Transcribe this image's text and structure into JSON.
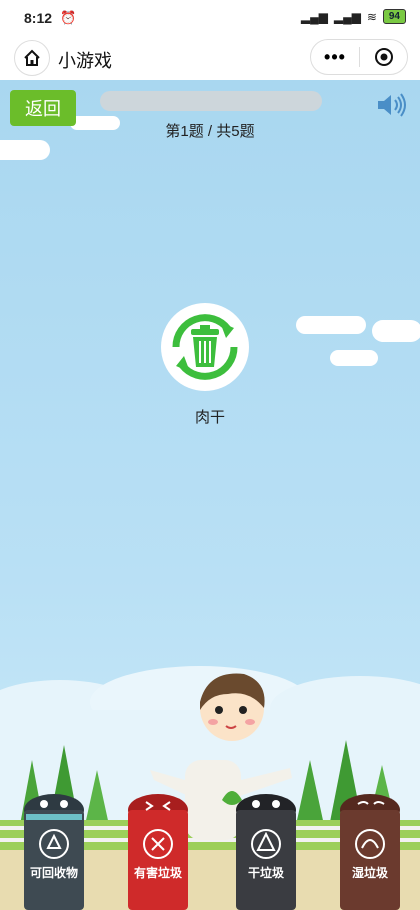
{
  "status": {
    "time": "8:12",
    "battery": "94"
  },
  "nav": {
    "title": "小游戏"
  },
  "game": {
    "back_label": "返回",
    "progress_fraction": 0,
    "question_counter": "第1题 / 共5题",
    "item_name": "肉干",
    "bins": [
      {
        "label": "可回收物",
        "color": "#3e4a52"
      },
      {
        "label": "有害垃圾",
        "color": "#cf2a2a"
      },
      {
        "label": "干垃圾",
        "color": "#3a3c41"
      },
      {
        "label": "湿垃圾",
        "color": "#6b3a2e"
      }
    ]
  },
  "colors": {
    "accent": "#6bbd2a",
    "recycle_green": "#3dbe3d"
  }
}
